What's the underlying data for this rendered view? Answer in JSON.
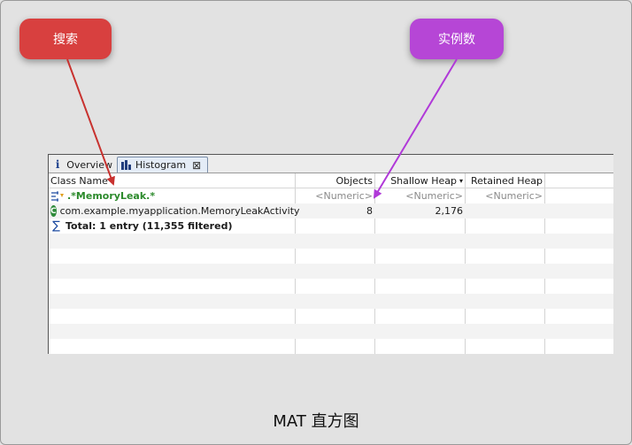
{
  "callouts": {
    "search": "搜索",
    "instance_count": "实例数"
  },
  "tabs": {
    "overview": "Overview",
    "histogram": "Histogram"
  },
  "columns": {
    "class_name": "Class Name",
    "objects": "Objects",
    "shallow_heap": "Shallow Heap",
    "retained_heap": "Retained Heap"
  },
  "filter_row": {
    "class_name": ".*MemoryLeak.*",
    "objects": "<Numeric>",
    "shallow_heap": "<Numeric>",
    "retained_heap": "<Numeric>"
  },
  "data_rows": [
    {
      "class_name": "com.example.myapplication.MemoryLeakActivity",
      "objects": "8",
      "shallow_heap": "2,176",
      "retained_heap": ""
    }
  ],
  "total_row": {
    "label": "Total: 1 entry (11,355 filtered)"
  },
  "caption": "MAT 直方图",
  "colors": {
    "search_callout": "#d8403f",
    "instance_callout": "#b646d6",
    "filter_text": "#2c8a2c"
  },
  "icons": {
    "overview": "info-icon",
    "histogram": "bar-chart-icon",
    "close": "close-icon",
    "filter": "filter-icon",
    "class": "class-icon",
    "total": "sigma-icon"
  }
}
